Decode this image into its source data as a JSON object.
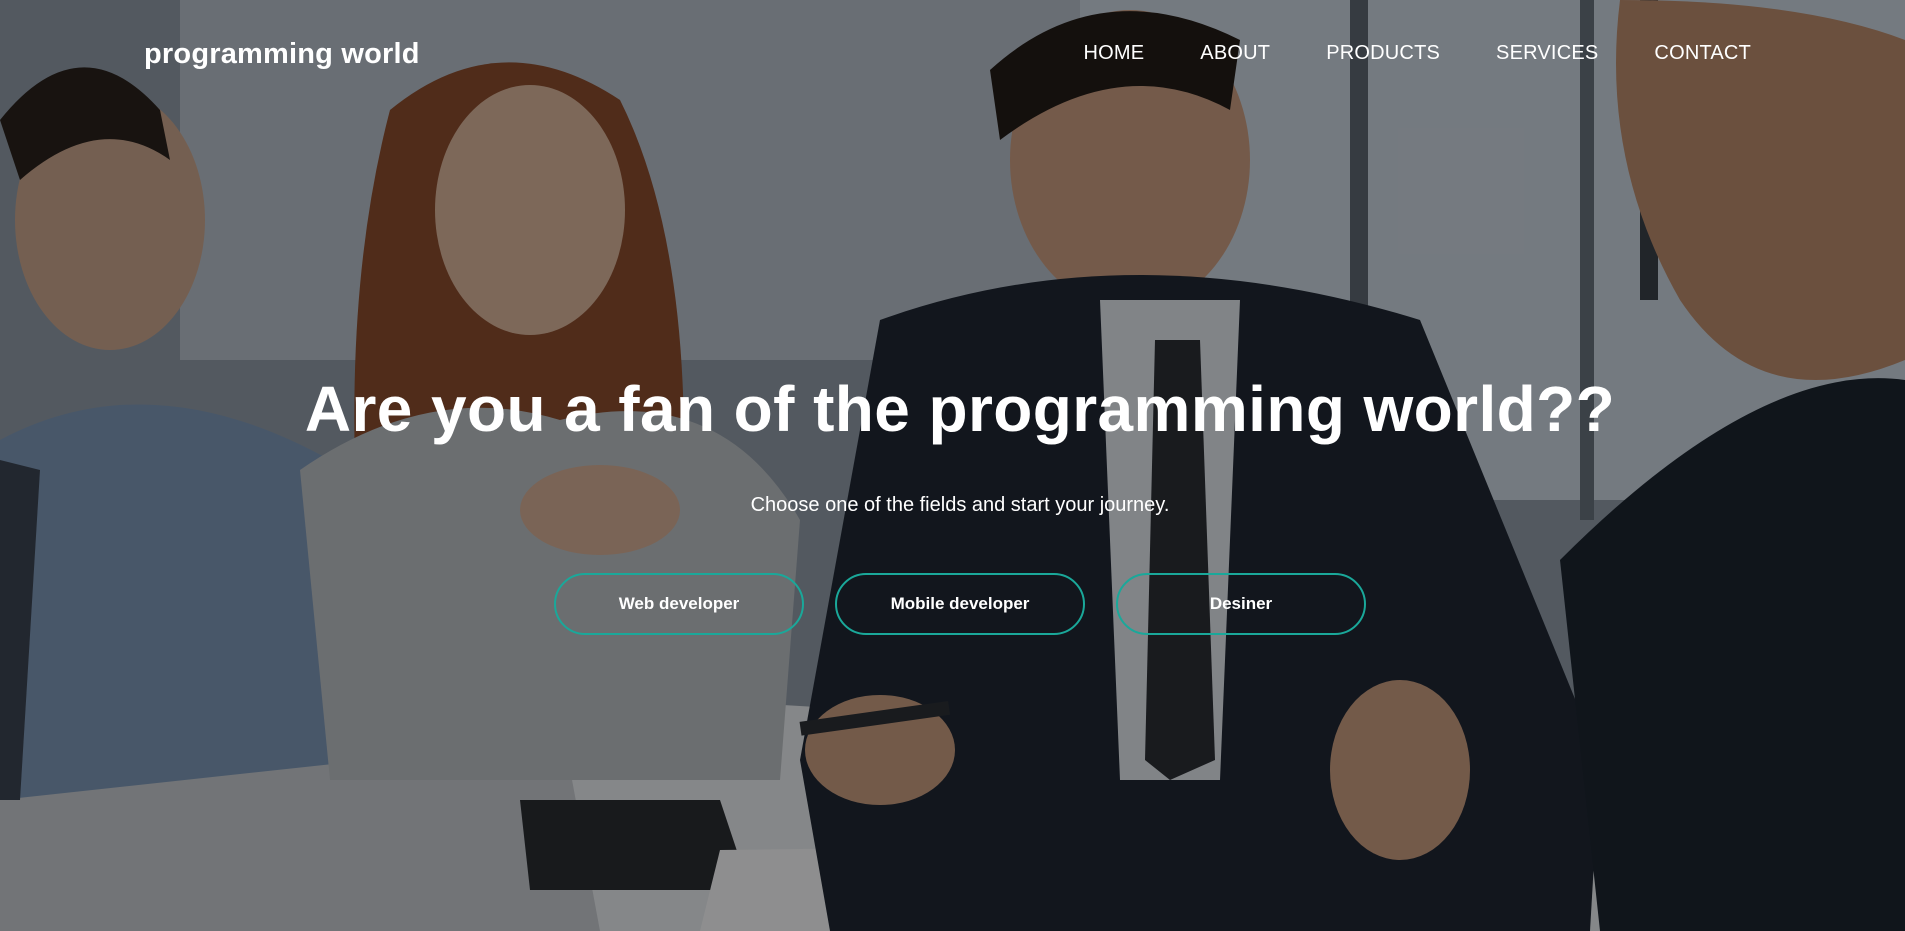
{
  "brand": {
    "name": "programming world"
  },
  "nav": {
    "items": [
      {
        "label": "HOME"
      },
      {
        "label": "ABOUT"
      },
      {
        "label": "PRODUCTS"
      },
      {
        "label": "SERVICES"
      },
      {
        "label": "CONTACT"
      }
    ]
  },
  "hero": {
    "headline": "Are you a fan of the programming world??",
    "subtitle": "Choose one of the fields and start your journey.",
    "buttons": [
      {
        "label": "Web developer"
      },
      {
        "label": "Mobile developer"
      },
      {
        "label": "Desiner"
      }
    ]
  },
  "colors": {
    "accent_border": "#1aa89a",
    "text": "#ffffff",
    "overlay": "rgba(0,0,0,0.42)"
  }
}
